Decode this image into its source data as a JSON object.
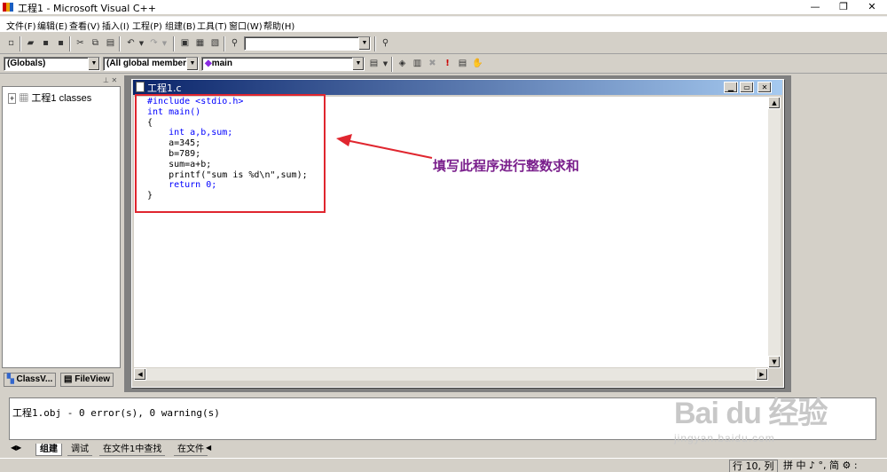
{
  "window": {
    "title": "工程1 - Microsoft Visual C++",
    "minimize": "—",
    "restore": "❐",
    "close": "✕"
  },
  "menu": [
    "文件(F)",
    "编辑(E)",
    "查看(V)",
    "插入(I)",
    "工程(P)",
    "组建(B)",
    "工具(T)",
    "窗口(W)",
    "帮助(H)"
  ],
  "toolbar2": {
    "combo_globals": "(Globals)",
    "combo_members": "(All global members",
    "combo_function": "main"
  },
  "workspace": {
    "tree_root": "工程1 classes",
    "tab_classview": "ClassV...",
    "tab_fileview": "FileView"
  },
  "editor": {
    "tab_title": "工程1.c",
    "code": [
      "#include <stdio.h>",
      "int main()",
      "{",
      "    int a,b,sum;",
      "    a=345;",
      "    b=789;",
      "    sum=a+b;",
      "    printf(\"sum is %d\\n\",sum);",
      "    return 0;",
      "}"
    ]
  },
  "annotation": "填写此程序进行整数求和",
  "output": {
    "line": "工程1.obj - 0 error(s), 0 warning(s)",
    "tabs": [
      "组建",
      "调试",
      "在文件1中查找",
      "在文件"
    ]
  },
  "status": {
    "position": "行 10, 列",
    "ime": "拼 中 ♪ °, 简 ⚙ :"
  },
  "watermark": {
    "brand": "Bai du 经验",
    "url": "jingyan.baidu.com"
  },
  "colors": {
    "titlebar_active": "#0a246a",
    "annotation": "#7a1f8c",
    "highlight_box": "#e0262f",
    "keyword": "#0000ff"
  }
}
